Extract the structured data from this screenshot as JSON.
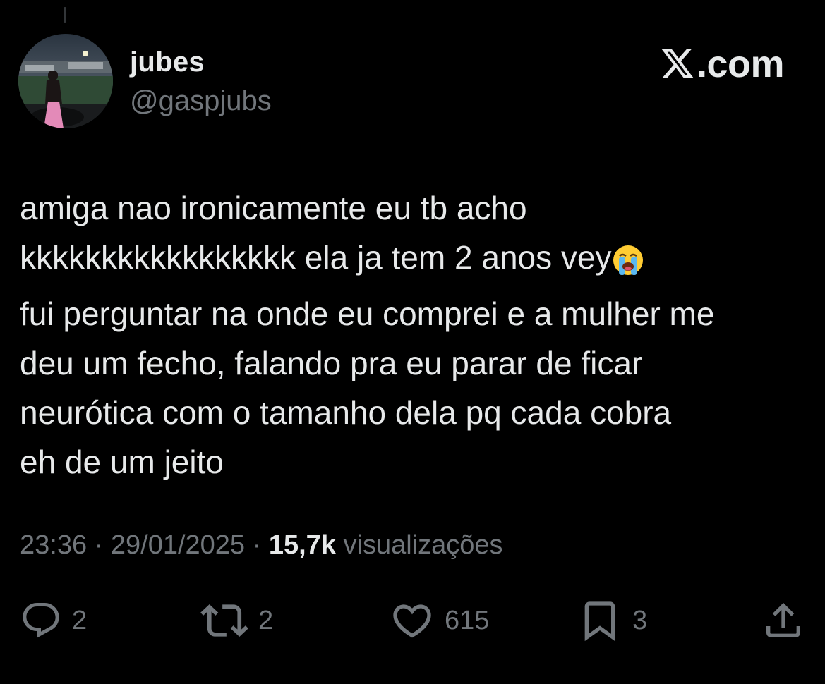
{
  "header": {
    "display_name": "jubes",
    "handle": "@gaspjubs",
    "brand": ".com",
    "brand_mark_icon": "x-logo-icon"
  },
  "tweet": {
    "lines": [
      "amiga nao ironicamente eu tb acho",
      "kkkkkkkkkkkkkkkkk ela ja tem 2 anos vey",
      "fui perguntar na onde eu comprei e a mulher me",
      "deu um fecho, falando pra eu parar de ficar",
      "neurótica com o tamanho dela pq cada cobra",
      "eh de um jeito"
    ],
    "emoji_icon": "loudly-crying-face-icon"
  },
  "meta": {
    "time": "23:36",
    "separator": " · ",
    "date": "29/01/2025",
    "views_count": "15,7k",
    "views_label": " visualizações"
  },
  "actions": {
    "reply": {
      "icon": "reply-icon",
      "count": "2"
    },
    "repost": {
      "icon": "repost-icon",
      "count": "2"
    },
    "like": {
      "icon": "heart-icon",
      "count": "615"
    },
    "bookmark": {
      "icon": "bookmark-icon",
      "count": "3"
    },
    "share": {
      "icon": "share-icon"
    }
  },
  "colors": {
    "background": "#000000",
    "primary_text": "#e7e9ea",
    "secondary_text": "#71767b"
  }
}
